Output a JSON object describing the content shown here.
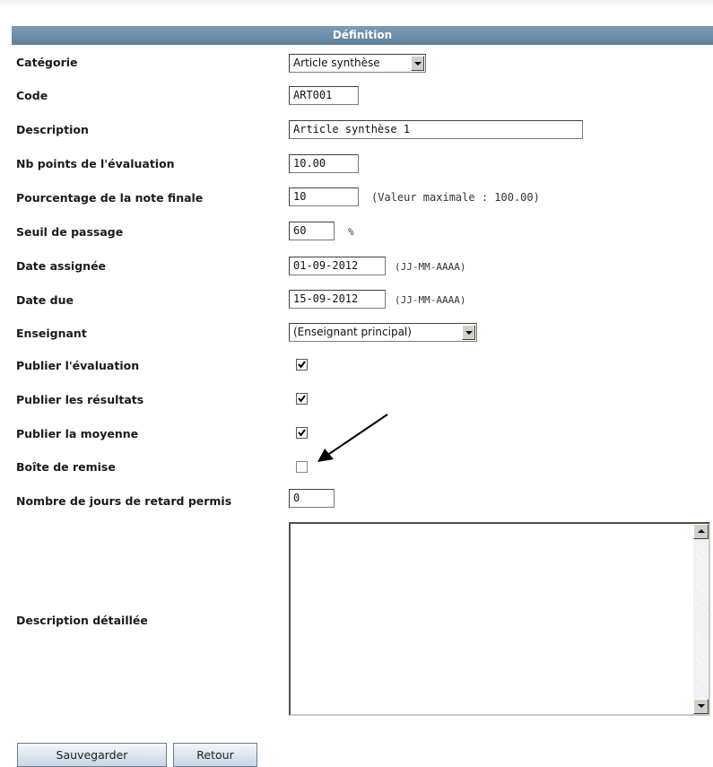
{
  "header": {
    "title": "Définition"
  },
  "fields": {
    "categorie": {
      "label": "Catégorie",
      "value": "Article synthèse"
    },
    "code": {
      "label": "Code",
      "value": "ART001"
    },
    "description": {
      "label": "Description",
      "value": "Article synthèse 1"
    },
    "nb_points": {
      "label": "Nb points de l'évaluation",
      "value": "10.00"
    },
    "pourcentage": {
      "label": "Pourcentage de la note finale",
      "value": "10",
      "hint": "(Valeur maximale : 100.00)"
    },
    "seuil": {
      "label": "Seuil de passage",
      "value": "60",
      "unit": "%"
    },
    "date_assignee": {
      "label": "Date assignée",
      "value": "01-09-2012",
      "hint": "(JJ-MM-AAAA)"
    },
    "date_due": {
      "label": "Date due",
      "value": "15-09-2012",
      "hint": "(JJ-MM-AAAA)"
    },
    "enseignant": {
      "label": "Enseignant",
      "value": "(Enseignant principal)"
    },
    "publier_evaluation": {
      "label": "Publier l'évaluation",
      "checked": true
    },
    "publier_resultats": {
      "label": "Publier les résultats",
      "checked": true
    },
    "publier_moyenne": {
      "label": "Publier la moyenne",
      "checked": true
    },
    "boite_remise": {
      "label": "Boîte de remise",
      "checked": false
    },
    "jours_retard": {
      "label": "Nombre de jours de retard permis",
      "value": "0"
    },
    "description_detaillee": {
      "label": "Description détaillée",
      "value": ""
    }
  },
  "buttons": {
    "save": "Sauvegarder",
    "back": "Retour"
  },
  "colors": {
    "header_bg": "#6a89a6",
    "button_border": "#6a7d91"
  }
}
